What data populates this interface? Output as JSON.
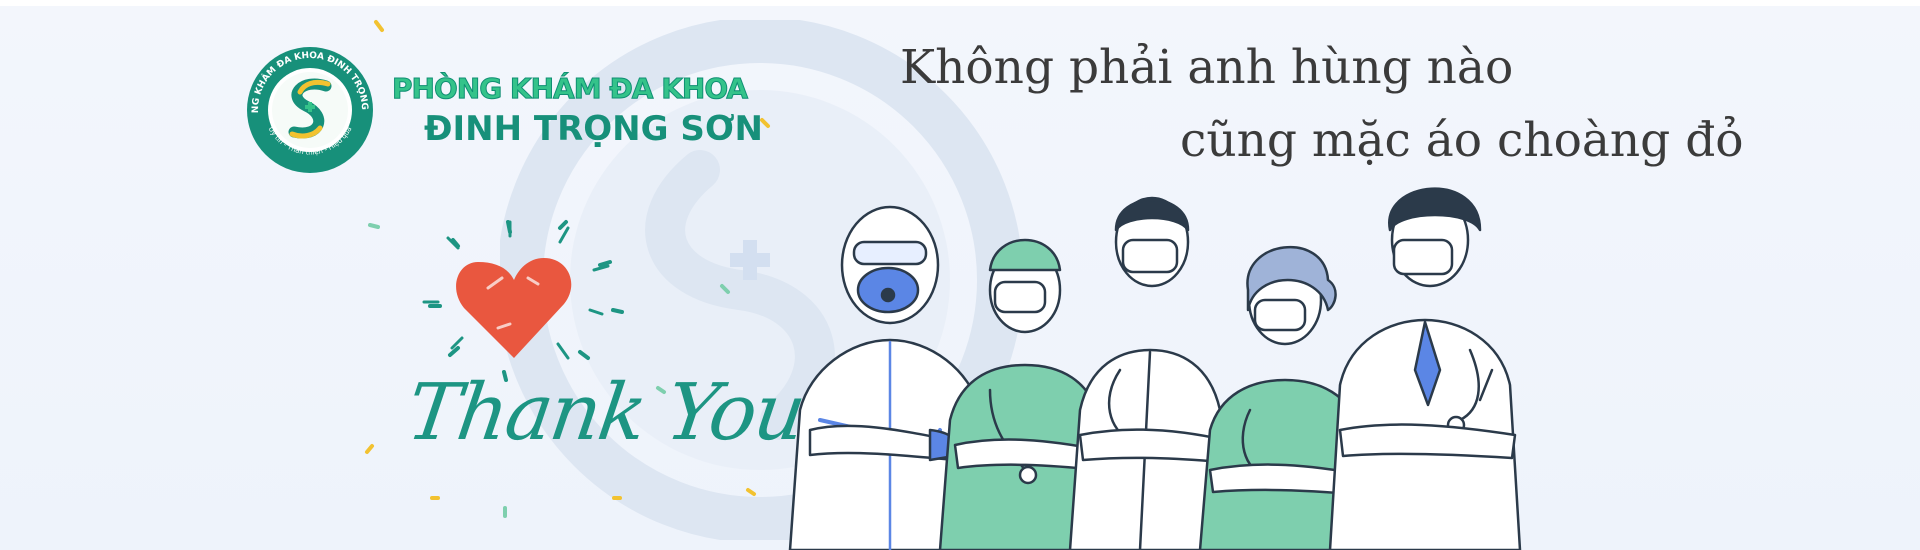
{
  "clinic": {
    "name_line1": "PHÒNG KHÁM ĐA KHOA",
    "name_line2": "ĐINH TRỌNG SƠN",
    "seal_text_top": "PHÒNG KHÁM ĐA KHOA ĐINH TRỌNG SƠN",
    "seal_text_bottom": "Uy tín - Thân thiện - Hiệu quả"
  },
  "headline": {
    "line1": "Không phải anh hùng nào",
    "line2": "cũng mặc áo choàng đỏ"
  },
  "thank_you": "Thank You",
  "colors": {
    "brand_green": "#17907a",
    "brand_light_green": "#34c38a",
    "heart_red": "#e9573f",
    "accent_yellow": "#f2c230",
    "scrub_green": "#7ecfae",
    "ink": "#2b3a4a",
    "ppe_blue": "#5b86e5"
  },
  "icons": [
    "clinic-logo-icon",
    "heart-icon",
    "watermark-logo-icon"
  ]
}
